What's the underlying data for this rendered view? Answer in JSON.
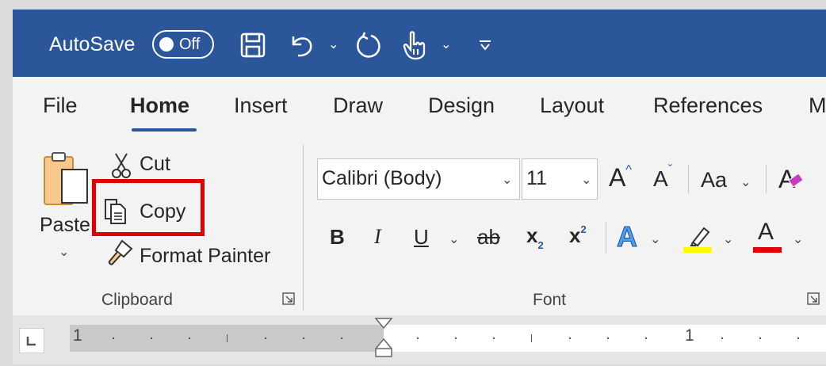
{
  "title_bar": {
    "autosave_label": "AutoSave",
    "autosave_toggle": "Off",
    "icons": [
      "save-icon",
      "undo-icon",
      "undo-dropdown-icon",
      "redo-icon",
      "touch-mode-icon",
      "touch-dropdown-icon",
      "customize-qat-icon"
    ]
  },
  "tabs": [
    {
      "label": "File"
    },
    {
      "label": "Home",
      "selected": true
    },
    {
      "label": "Insert"
    },
    {
      "label": "Draw"
    },
    {
      "label": "Design"
    },
    {
      "label": "Layout"
    },
    {
      "label": "References"
    },
    {
      "label": "M"
    }
  ],
  "clipboard": {
    "paste": "Paste",
    "cut": "Cut",
    "copy": "Copy",
    "format_painter": "Format Painter",
    "group_label": "Clipboard",
    "highlighted": "Copy"
  },
  "font": {
    "font_name": "Calibri (Body)",
    "font_size": "11",
    "grow_font": "A",
    "shrink_font": "A",
    "change_case": "Aa",
    "clear_formatting": "A",
    "bold": "B",
    "italic": "I",
    "underline": "U",
    "strikethrough": "ab",
    "subscript": "x",
    "subscript_mark": "2",
    "superscript": "x",
    "superscript_mark": "2",
    "text_effects": "A",
    "font_color": "A",
    "group_label": "Font"
  },
  "colors": {
    "title_bar": "#2b579a",
    "highlight_border": "#e00000",
    "highlight_color": "#ffff00",
    "font_color": "#e00000"
  },
  "ruler": {
    "left_number": "1",
    "right_number": "1"
  }
}
